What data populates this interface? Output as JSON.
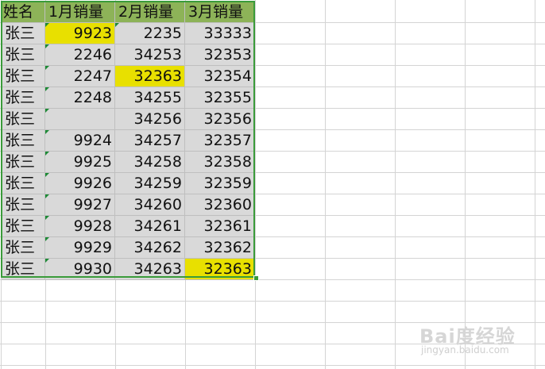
{
  "sheet": {
    "headers": [
      "姓名",
      "1月销量",
      "2月销量",
      "3月销量"
    ],
    "rows": [
      [
        "张三",
        "9923",
        "2235",
        "33333"
      ],
      [
        "张三",
        "2246",
        "34253",
        "32353"
      ],
      [
        "张三",
        "2247",
        "32363",
        "32354"
      ],
      [
        "张三",
        "2248",
        "34255",
        "32355"
      ],
      [
        "张三",
        "",
        "34256",
        "32356"
      ],
      [
        "张三",
        "9924",
        "34257",
        "32357"
      ],
      [
        "张三",
        "9925",
        "34258",
        "32358"
      ],
      [
        "张三",
        "9926",
        "34259",
        "32359"
      ],
      [
        "张三",
        "9927",
        "34260",
        "32360"
      ],
      [
        "张三",
        "9928",
        "34261",
        "32361"
      ],
      [
        "张三",
        "9929",
        "34262",
        "32362"
      ],
      [
        "张三",
        "9930",
        "34263",
        "32363"
      ]
    ],
    "highlight_color": "#e8e000",
    "header_color": "#8db358",
    "data_fill": "#d9d9d9",
    "highlighted_cells": [
      [
        0,
        1
      ],
      [
        2,
        2
      ],
      [
        11,
        3
      ]
    ],
    "error_marker_cells": [
      [
        0,
        1
      ],
      [
        1,
        1
      ],
      [
        2,
        1
      ],
      [
        3,
        1
      ],
      [
        4,
        1
      ],
      [
        5,
        1
      ],
      [
        6,
        1
      ],
      [
        7,
        1
      ],
      [
        8,
        1
      ],
      [
        9,
        1
      ],
      [
        10,
        1
      ],
      [
        11,
        1
      ],
      [
        0,
        2
      ]
    ]
  },
  "watermark": {
    "logo": "Bai度经验",
    "url": "jingyan.baidu.com"
  }
}
